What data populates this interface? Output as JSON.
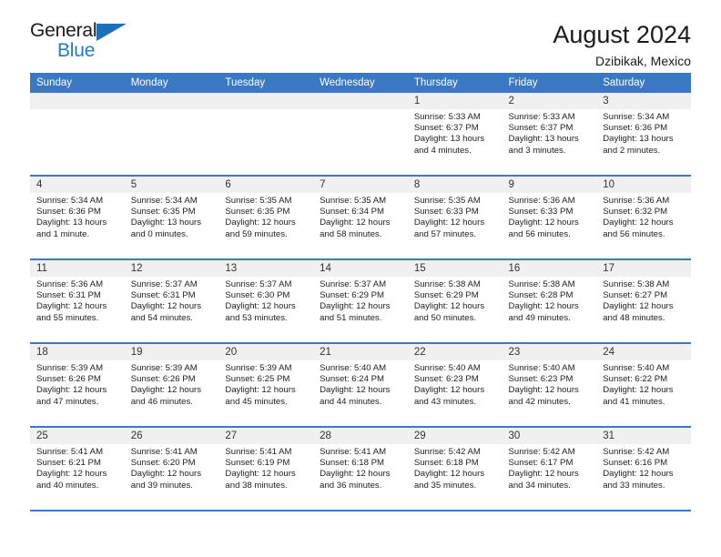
{
  "brand": {
    "name_top": "General",
    "name_bottom": "Blue"
  },
  "header": {
    "title": "August 2024",
    "location": "Dzibikak, Mexico"
  },
  "colors": {
    "header_blue": "#3b78c3",
    "logo_blue": "#1e7bc4",
    "daynum_bg": "#f0f0f0"
  },
  "weekdays": [
    "Sunday",
    "Monday",
    "Tuesday",
    "Wednesday",
    "Thursday",
    "Friday",
    "Saturday"
  ],
  "labels": {
    "sunrise_prefix": "Sunrise:",
    "sunset_prefix": "Sunset:",
    "daylight_prefix": "Daylight:"
  },
  "weeks": [
    [
      {
        "day": "",
        "lines": [
          "",
          "",
          ""
        ]
      },
      {
        "day": "",
        "lines": [
          "",
          "",
          ""
        ]
      },
      {
        "day": "",
        "lines": [
          "",
          "",
          ""
        ]
      },
      {
        "day": "",
        "lines": [
          "",
          "",
          ""
        ]
      },
      {
        "day": "1",
        "lines": [
          "Sunrise: 5:33 AM",
          "Sunset: 6:37 PM",
          "Daylight: 13 hours and 4 minutes."
        ]
      },
      {
        "day": "2",
        "lines": [
          "Sunrise: 5:33 AM",
          "Sunset: 6:37 PM",
          "Daylight: 13 hours and 3 minutes."
        ]
      },
      {
        "day": "3",
        "lines": [
          "Sunrise: 5:34 AM",
          "Sunset: 6:36 PM",
          "Daylight: 13 hours and 2 minutes."
        ]
      }
    ],
    [
      {
        "day": "4",
        "lines": [
          "Sunrise: 5:34 AM",
          "Sunset: 6:36 PM",
          "Daylight: 13 hours and 1 minute."
        ]
      },
      {
        "day": "5",
        "lines": [
          "Sunrise: 5:34 AM",
          "Sunset: 6:35 PM",
          "Daylight: 13 hours and 0 minutes."
        ]
      },
      {
        "day": "6",
        "lines": [
          "Sunrise: 5:35 AM",
          "Sunset: 6:35 PM",
          "Daylight: 12 hours and 59 minutes."
        ]
      },
      {
        "day": "7",
        "lines": [
          "Sunrise: 5:35 AM",
          "Sunset: 6:34 PM",
          "Daylight: 12 hours and 58 minutes."
        ]
      },
      {
        "day": "8",
        "lines": [
          "Sunrise: 5:35 AM",
          "Sunset: 6:33 PM",
          "Daylight: 12 hours and 57 minutes."
        ]
      },
      {
        "day": "9",
        "lines": [
          "Sunrise: 5:36 AM",
          "Sunset: 6:33 PM",
          "Daylight: 12 hours and 56 minutes."
        ]
      },
      {
        "day": "10",
        "lines": [
          "Sunrise: 5:36 AM",
          "Sunset: 6:32 PM",
          "Daylight: 12 hours and 56 minutes."
        ]
      }
    ],
    [
      {
        "day": "11",
        "lines": [
          "Sunrise: 5:36 AM",
          "Sunset: 6:31 PM",
          "Daylight: 12 hours and 55 minutes."
        ]
      },
      {
        "day": "12",
        "lines": [
          "Sunrise: 5:37 AM",
          "Sunset: 6:31 PM",
          "Daylight: 12 hours and 54 minutes."
        ]
      },
      {
        "day": "13",
        "lines": [
          "Sunrise: 5:37 AM",
          "Sunset: 6:30 PM",
          "Daylight: 12 hours and 53 minutes."
        ]
      },
      {
        "day": "14",
        "lines": [
          "Sunrise: 5:37 AM",
          "Sunset: 6:29 PM",
          "Daylight: 12 hours and 51 minutes."
        ]
      },
      {
        "day": "15",
        "lines": [
          "Sunrise: 5:38 AM",
          "Sunset: 6:29 PM",
          "Daylight: 12 hours and 50 minutes."
        ]
      },
      {
        "day": "16",
        "lines": [
          "Sunrise: 5:38 AM",
          "Sunset: 6:28 PM",
          "Daylight: 12 hours and 49 minutes."
        ]
      },
      {
        "day": "17",
        "lines": [
          "Sunrise: 5:38 AM",
          "Sunset: 6:27 PM",
          "Daylight: 12 hours and 48 minutes."
        ]
      }
    ],
    [
      {
        "day": "18",
        "lines": [
          "Sunrise: 5:39 AM",
          "Sunset: 6:26 PM",
          "Daylight: 12 hours and 47 minutes."
        ]
      },
      {
        "day": "19",
        "lines": [
          "Sunrise: 5:39 AM",
          "Sunset: 6:26 PM",
          "Daylight: 12 hours and 46 minutes."
        ]
      },
      {
        "day": "20",
        "lines": [
          "Sunrise: 5:39 AM",
          "Sunset: 6:25 PM",
          "Daylight: 12 hours and 45 minutes."
        ]
      },
      {
        "day": "21",
        "lines": [
          "Sunrise: 5:40 AM",
          "Sunset: 6:24 PM",
          "Daylight: 12 hours and 44 minutes."
        ]
      },
      {
        "day": "22",
        "lines": [
          "Sunrise: 5:40 AM",
          "Sunset: 6:23 PM",
          "Daylight: 12 hours and 43 minutes."
        ]
      },
      {
        "day": "23",
        "lines": [
          "Sunrise: 5:40 AM",
          "Sunset: 6:23 PM",
          "Daylight: 12 hours and 42 minutes."
        ]
      },
      {
        "day": "24",
        "lines": [
          "Sunrise: 5:40 AM",
          "Sunset: 6:22 PM",
          "Daylight: 12 hours and 41 minutes."
        ]
      }
    ],
    [
      {
        "day": "25",
        "lines": [
          "Sunrise: 5:41 AM",
          "Sunset: 6:21 PM",
          "Daylight: 12 hours and 40 minutes."
        ]
      },
      {
        "day": "26",
        "lines": [
          "Sunrise: 5:41 AM",
          "Sunset: 6:20 PM",
          "Daylight: 12 hours and 39 minutes."
        ]
      },
      {
        "day": "27",
        "lines": [
          "Sunrise: 5:41 AM",
          "Sunset: 6:19 PM",
          "Daylight: 12 hours and 38 minutes."
        ]
      },
      {
        "day": "28",
        "lines": [
          "Sunrise: 5:41 AM",
          "Sunset: 6:18 PM",
          "Daylight: 12 hours and 36 minutes."
        ]
      },
      {
        "day": "29",
        "lines": [
          "Sunrise: 5:42 AM",
          "Sunset: 6:18 PM",
          "Daylight: 12 hours and 35 minutes."
        ]
      },
      {
        "day": "30",
        "lines": [
          "Sunrise: 5:42 AM",
          "Sunset: 6:17 PM",
          "Daylight: 12 hours and 34 minutes."
        ]
      },
      {
        "day": "31",
        "lines": [
          "Sunrise: 5:42 AM",
          "Sunset: 6:16 PM",
          "Daylight: 12 hours and 33 minutes."
        ]
      }
    ]
  ]
}
